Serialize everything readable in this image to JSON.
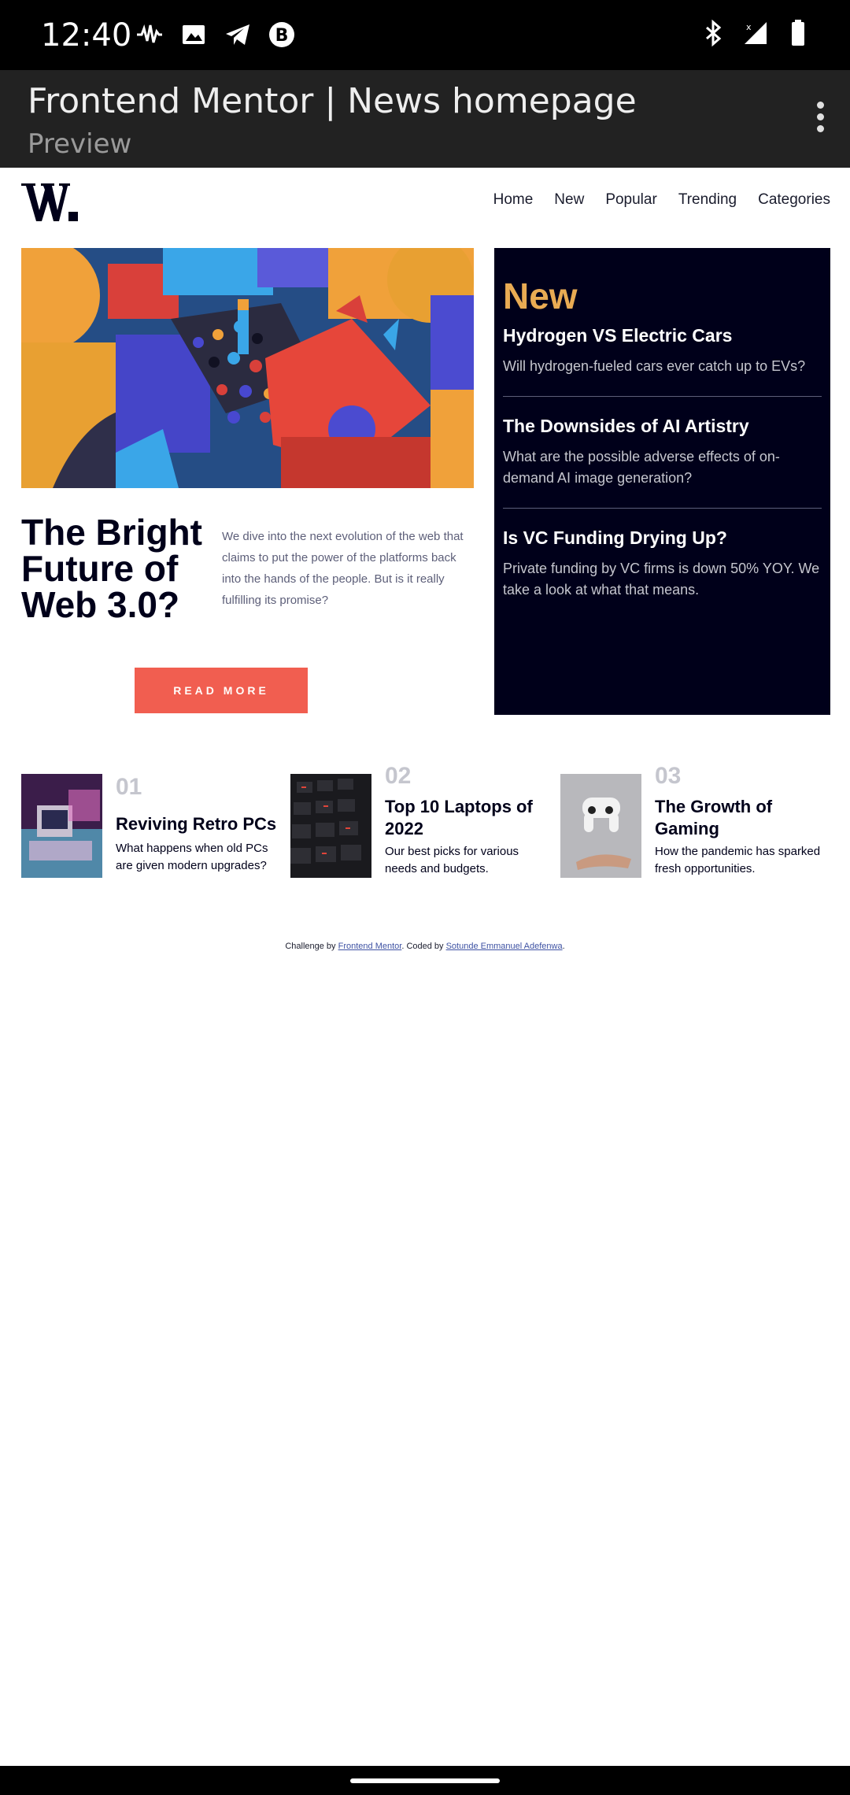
{
  "status_bar": {
    "time": "12:40",
    "left_icons": [
      "podcast-icon",
      "image-icon",
      "telegram-icon",
      "b-circle-icon"
    ],
    "right_icons": [
      "bluetooth-icon",
      "no-signal-icon",
      "battery-icon"
    ]
  },
  "browser": {
    "title": "Frontend Mentor | News homepage",
    "subtitle": "Preview"
  },
  "site": {
    "logo": "W.",
    "nav": [
      "Home",
      "New",
      "Popular",
      "Trending",
      "Categories"
    ]
  },
  "hero": {
    "title": "The Bright Future of Web 3.0?",
    "text": "We dive into the next evolution of the web that claims to put the power of the platforms back into the hands of the people. But is it really fulfilling its promise?",
    "button": "READ MORE"
  },
  "new_section": {
    "heading": "New",
    "items": [
      {
        "title": "Hydrogen VS Electric Cars",
        "text": "Will hydrogen-fueled cars ever catch up to EVs?"
      },
      {
        "title": "The Downsides of AI Artistry",
        "text": "What are the possible adverse effects of on-demand AI image generation?"
      },
      {
        "title": "Is VC Funding Drying Up?",
        "text": "Private funding by VC firms is down 50% YOY. We take a look at what that means."
      }
    ]
  },
  "cards": [
    {
      "num": "01",
      "title": "Reviving Retro PCs",
      "text": "What happens when old PCs are given modern upgrades?"
    },
    {
      "num": "02",
      "title": "Top 10 Laptops of 2022",
      "text": "Our best picks for various needs and budgets."
    },
    {
      "num": "03",
      "title": "The Growth of Gaming",
      "text": "How the pandemic has sparked fresh opportunities."
    }
  ],
  "footer": {
    "prefix": "Challenge by ",
    "link1": "Frontend Mentor",
    "middle": ". Coded by ",
    "link2": "Sotunde Emmanuel Adefenwa",
    "suffix": "."
  },
  "colors": {
    "accent": "#f15e50",
    "gold": "#e9ab53",
    "navy": "#00001a"
  }
}
